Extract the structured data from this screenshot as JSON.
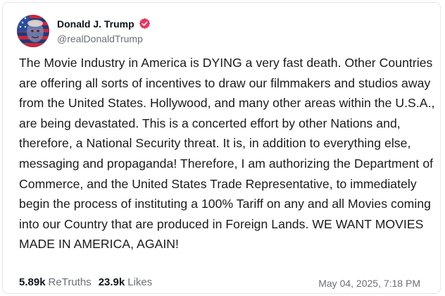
{
  "author": {
    "display_name": "Donald J. Trump",
    "handle": "@realDonaldTrump",
    "verified_icon": "verified-badge-icon",
    "badge_color": "#e8385d"
  },
  "post": {
    "text": "The Movie Industry in America is DYING a very fast death. Other Countries are offering all sorts of incentives to draw our filmmakers and studios away from the United States. Hollywood, and many other areas within the U.S.A., are being devastated. This is a concerted effort by other Nations and, therefore, a National Security threat. It is, in addition to everything else, messaging and propaganda! Therefore, I am authorizing the Department of Commerce, and the United States Trade Representative, to immediately begin the process of instituting a 100% Tariff on any and all Movies coming into our Country that are produced in Foreign Lands. WE WANT MOVIES MADE IN AMERICA, AGAIN!",
    "retruths_count": "5.89k",
    "retruths_label": "ReTruths",
    "likes_count": "23.9k",
    "likes_label": "Likes",
    "timestamp": "May 04, 2025, 7:18 PM"
  }
}
